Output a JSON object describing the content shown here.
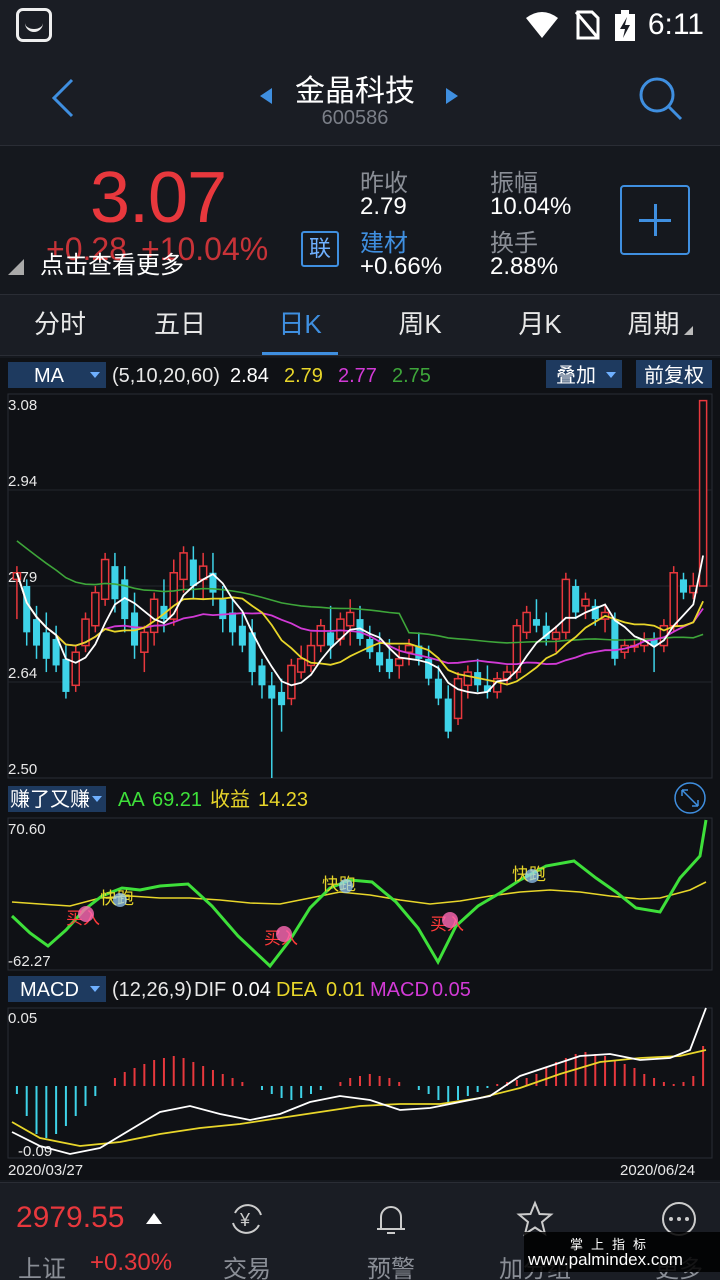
{
  "status": {
    "time": "6:11"
  },
  "header": {
    "name": "金晶科技",
    "code": "600586"
  },
  "quote": {
    "price": "3.07",
    "change": "+0.28",
    "change_pct": "+10.04%",
    "hint": "点击查看更多",
    "lian": "联",
    "prev_close_label": "昨收",
    "prev_close": "2.79",
    "sector_label": "建材",
    "sector_chg": "+0.66%",
    "amplitude_label": "振幅",
    "amplitude": "10.04%",
    "turnover_label": "换手",
    "turnover": "2.88%"
  },
  "tabs": [
    "分时",
    "五日",
    "日K",
    "周K",
    "月K",
    "周期"
  ],
  "active_tab": 2,
  "ma_panel": {
    "indicator": "MA",
    "params": "(5,10,20,60)",
    "v1": "2.84",
    "v2": "2.79",
    "v3": "2.77",
    "v4": "2.75",
    "overlay_btn": "叠加",
    "adjust_btn": "前复权",
    "y_max": "3.08",
    "y_2": "2.94",
    "y_3": "2.79",
    "y_4": "2.64",
    "y_min": "2.50"
  },
  "aa_panel": {
    "indicator": "赚了又赚",
    "aa_label": "AA",
    "aa_value": "69.21",
    "gain_label": "收益",
    "gain_value": "14.23",
    "y_max": "70.60",
    "y_min": "-62.27",
    "buy_label": "买入",
    "run_label": "快跑"
  },
  "macd_panel": {
    "indicator": "MACD",
    "params": "(12,26,9)",
    "dif_label": "DIF",
    "dif": "0.04",
    "dea_label": "DEA",
    "dea": "0.01",
    "macd_label": "MACD",
    "macd": "0.05",
    "y_max": "0.05",
    "y_min": "-0.09",
    "date_start": "2020/03/27",
    "date_end": "2020/06/24"
  },
  "bottom": {
    "index_value": "2979.55",
    "index_name": "上证",
    "index_chg": "+0.30%",
    "nav": [
      "交易",
      "预警",
      "加分组",
      "更多"
    ]
  },
  "watermark": {
    "line1": "掌上指标",
    "line2": "www.palmindex.com"
  },
  "colors": {
    "up": "#e8383d",
    "down": "#3ed3e8",
    "accent": "#3f8fe0",
    "ma5": "#ffffff",
    "ma10": "#e8d62a",
    "ma20": "#d23ad6",
    "ma60": "#3ea63a"
  },
  "chart_data": {
    "type": "candlestick",
    "ylim": [
      2.5,
      3.08
    ],
    "candles": [
      [
        2.8,
        2.82,
        2.74,
        2.81
      ],
      [
        2.79,
        2.8,
        2.7,
        2.72
      ],
      [
        2.74,
        2.76,
        2.68,
        2.7
      ],
      [
        2.72,
        2.75,
        2.66,
        2.68
      ],
      [
        2.71,
        2.73,
        2.66,
        2.67
      ],
      [
        2.68,
        2.7,
        2.62,
        2.63
      ],
      [
        2.64,
        2.7,
        2.63,
        2.69
      ],
      [
        2.7,
        2.75,
        2.69,
        2.74
      ],
      [
        2.73,
        2.79,
        2.72,
        2.78
      ],
      [
        2.77,
        2.84,
        2.76,
        2.83
      ],
      [
        2.82,
        2.84,
        2.75,
        2.77
      ],
      [
        2.8,
        2.82,
        2.72,
        2.74
      ],
      [
        2.75,
        2.78,
        2.68,
        2.7
      ],
      [
        2.69,
        2.73,
        2.66,
        2.72
      ],
      [
        2.72,
        2.78,
        2.7,
        2.77
      ],
      [
        2.76,
        2.8,
        2.72,
        2.74
      ],
      [
        2.74,
        2.83,
        2.73,
        2.81
      ],
      [
        2.8,
        2.85,
        2.78,
        2.84
      ],
      [
        2.83,
        2.85,
        2.77,
        2.79
      ],
      [
        2.8,
        2.84,
        2.77,
        2.82
      ],
      [
        2.81,
        2.84,
        2.76,
        2.78
      ],
      [
        2.77,
        2.79,
        2.72,
        2.74
      ],
      [
        2.75,
        2.77,
        2.7,
        2.72
      ],
      [
        2.73,
        2.75,
        2.69,
        2.7
      ],
      [
        2.72,
        2.74,
        2.64,
        2.66
      ],
      [
        2.67,
        2.68,
        2.62,
        2.64
      ],
      [
        2.64,
        2.66,
        2.5,
        2.62
      ],
      [
        2.63,
        2.65,
        2.57,
        2.61
      ],
      [
        2.62,
        2.68,
        2.61,
        2.67
      ],
      [
        2.66,
        2.7,
        2.65,
        2.68
      ],
      [
        2.67,
        2.72,
        2.66,
        2.7
      ],
      [
        2.7,
        2.74,
        2.69,
        2.73
      ],
      [
        2.72,
        2.76,
        2.68,
        2.7
      ],
      [
        2.71,
        2.75,
        2.7,
        2.74
      ],
      [
        2.73,
        2.77,
        2.7,
        2.75
      ],
      [
        2.74,
        2.76,
        2.7,
        2.71
      ],
      [
        2.71,
        2.73,
        2.68,
        2.69
      ],
      [
        2.69,
        2.72,
        2.66,
        2.67
      ],
      [
        2.68,
        2.71,
        2.65,
        2.66
      ],
      [
        2.67,
        2.7,
        2.65,
        2.68
      ],
      [
        2.69,
        2.71,
        2.67,
        2.7
      ],
      [
        2.7,
        2.72,
        2.67,
        2.68
      ],
      [
        2.68,
        2.7,
        2.64,
        2.65
      ],
      [
        2.65,
        2.67,
        2.61,
        2.62
      ],
      [
        2.62,
        2.64,
        2.56,
        2.57
      ],
      [
        2.59,
        2.66,
        2.58,
        2.65
      ],
      [
        2.64,
        2.67,
        2.62,
        2.66
      ],
      [
        2.66,
        2.68,
        2.63,
        2.64
      ],
      [
        2.64,
        2.67,
        2.62,
        2.63
      ],
      [
        2.63,
        2.66,
        2.62,
        2.65
      ],
      [
        2.65,
        2.67,
        2.64,
        2.66
      ],
      [
        2.66,
        2.74,
        2.65,
        2.73
      ],
      [
        2.72,
        2.76,
        2.71,
        2.75
      ],
      [
        2.74,
        2.77,
        2.72,
        2.73
      ],
      [
        2.73,
        2.75,
        2.7,
        2.71
      ],
      [
        2.71,
        2.73,
        2.69,
        2.72
      ],
      [
        2.72,
        2.81,
        2.71,
        2.8
      ],
      [
        2.79,
        2.8,
        2.74,
        2.75
      ],
      [
        2.76,
        2.78,
        2.74,
        2.77
      ],
      [
        2.76,
        2.77,
        2.73,
        2.74
      ],
      [
        2.74,
        2.76,
        2.72,
        2.75
      ],
      [
        2.74,
        2.75,
        2.67,
        2.68
      ],
      [
        2.69,
        2.71,
        2.68,
        2.7
      ],
      [
        2.7,
        2.71,
        2.69,
        2.7
      ],
      [
        2.7,
        2.72,
        2.69,
        2.71
      ],
      [
        2.71,
        2.72,
        2.66,
        2.7
      ],
      [
        2.7,
        2.74,
        2.69,
        2.73
      ],
      [
        2.73,
        2.82,
        2.72,
        2.81
      ],
      [
        2.8,
        2.81,
        2.77,
        2.78
      ],
      [
        2.78,
        2.81,
        2.77,
        2.79
      ],
      [
        2.79,
        3.07,
        2.79,
        3.07
      ]
    ]
  }
}
